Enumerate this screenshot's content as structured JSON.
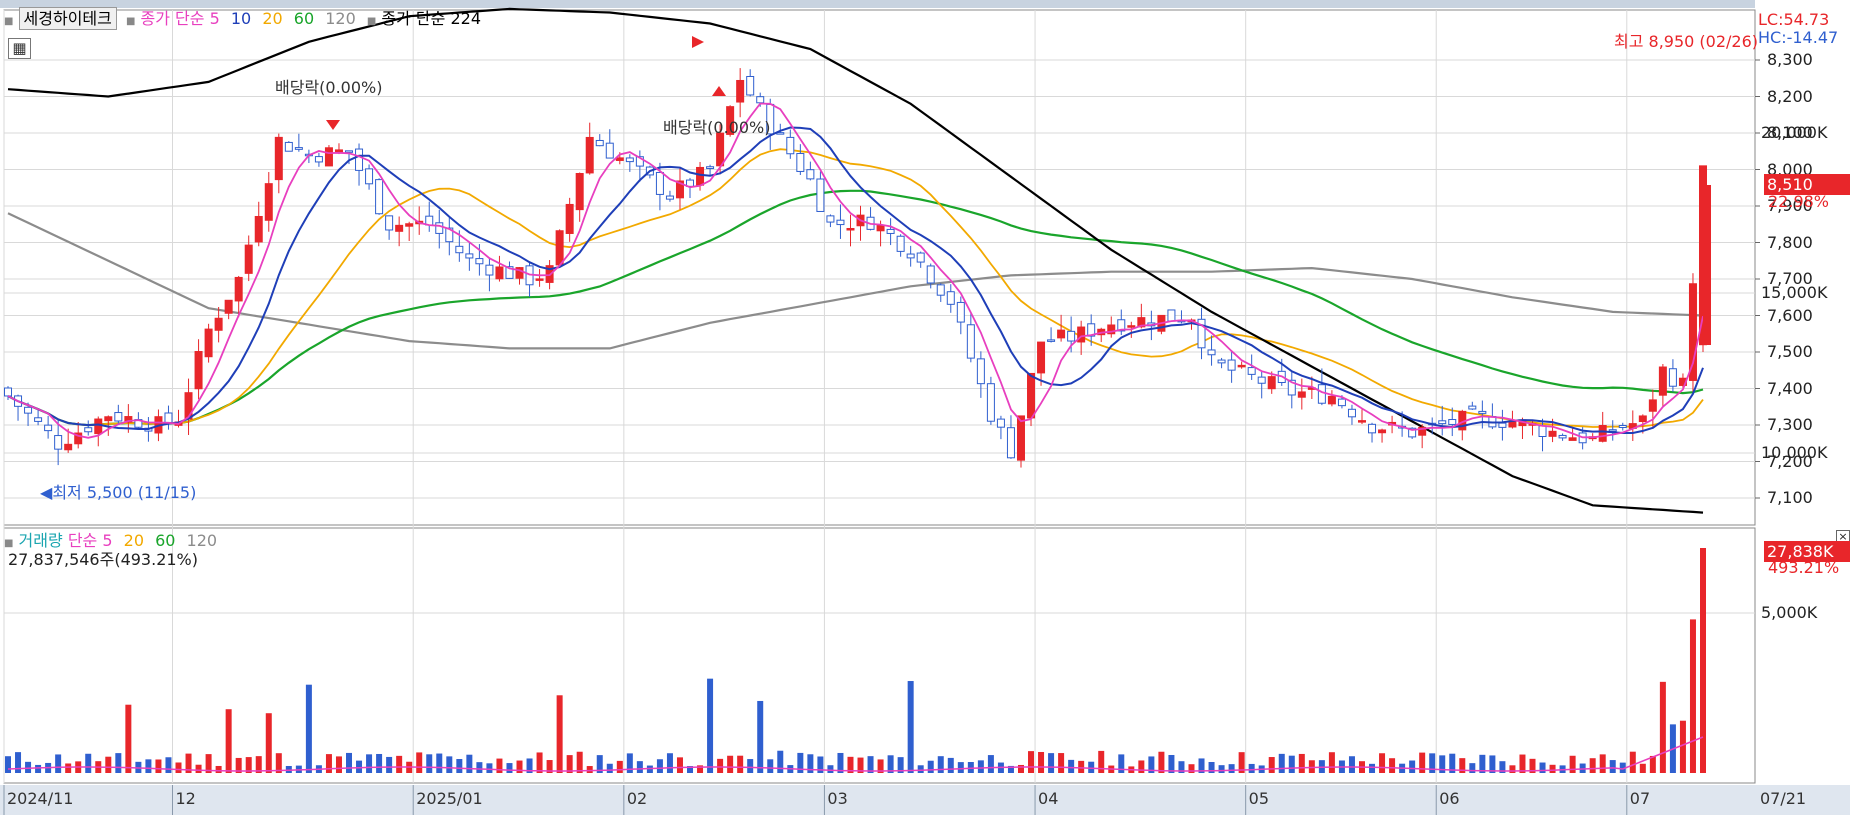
{
  "colors": {
    "up": "#e8262a",
    "down": "#2f5fcf",
    "ma5": "#e83fbf",
    "ma10": "#1f3fb8",
    "ma20": "#f2a900",
    "ma60": "#1aa52b",
    "ma120": "#8c8c8c",
    "ma224": "#000000",
    "grid": "#d9d9d9",
    "axis_bg": "#ffffff",
    "date_bar": "#dfe6ef"
  },
  "price_panel": {
    "stock_name": "세경하이테크",
    "legend_type": "종가 단순",
    "ma_periods": [
      "5",
      "10",
      "20",
      "60",
      "120"
    ],
    "ma224_label": "종가 단순 224",
    "lc_label": "LC:54.73",
    "hc_label": "HC:-14.47",
    "current_price_tag": "8,510",
    "current_change_tag": "22.98%",
    "high_note": "최고 8,950 (02/26)",
    "low_note": "최저 5,500 (11/15)",
    "dividend_note_1": "배당락(0.00%)",
    "dividend_note_2": "배당락(0.00%)",
    "y_ticks": [
      "8,300",
      "8,200",
      "8,100",
      "8,000",
      "7,900",
      "7,800",
      "7,700",
      "7,600",
      "7,500",
      "7,400",
      "7,300",
      "7,200",
      "7,100"
    ]
  },
  "volume_panel": {
    "title": "거래량",
    "legend_type": "단순",
    "ma_periods": [
      "5",
      "20",
      "60",
      "120"
    ],
    "info": "27,837,546주(493.21%)",
    "volume_tag": "27,838K",
    "volume_pct_tag": "493.21%",
    "y_ticks": [
      "20,000K",
      "15,000K",
      "10,000K",
      "5,000K"
    ]
  },
  "x_axis": {
    "labels": [
      "2024/11",
      "12",
      "2025/01",
      "02",
      "03",
      "04",
      "05",
      "06",
      "07"
    ],
    "right_label": "07/21"
  },
  "chart_data": {
    "type": "candlestick",
    "y_axis_ticks": [
      8300,
      8200,
      8100,
      8000,
      7900,
      7800,
      7700,
      7600,
      7500,
      7400,
      7300,
      7200,
      7100
    ],
    "last_price": 8510,
    "high": {
      "value": 8950,
      "date": "02/26"
    },
    "low": {
      "value": 5500,
      "date": "11/15"
    },
    "volume_ticks": [
      20000,
      15000,
      10000,
      5000
    ],
    "last_volume": 27837546,
    "last_volume_pct": 493.21
  }
}
